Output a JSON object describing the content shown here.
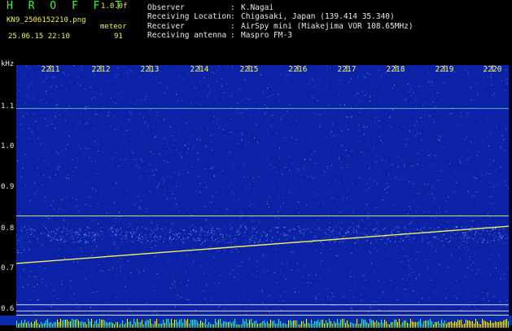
{
  "header": {
    "title": "H R O F F T",
    "version": "1.0.0f",
    "filename": "KN9_2506152210.png",
    "mode": "meteor",
    "datetime": "25.06.15 22:10",
    "count": "91",
    "fields": [
      {
        "label": "Observer",
        "value": "K.Nagai"
      },
      {
        "label": "Receiving Location",
        "value": "Chigasaki, Japan (139.414 35.340)"
      },
      {
        "label": "Receiver",
        "value": "AirSpy mini (Miakejima VOR 108.65MHz)"
      },
      {
        "label": "Receiving antenna",
        "value": "Maspro FM-3"
      }
    ],
    "separator": ":"
  },
  "spectrogram": {
    "y_unit": "kHz",
    "y_ticks": [
      "1.1",
      "1.0",
      "0.9",
      "0.8",
      "0.7",
      "0.6"
    ],
    "x_ticks": [
      "2211",
      "2212",
      "2213",
      "2214",
      "2215",
      "2216",
      "2217",
      "2218",
      "2219",
      "2220"
    ],
    "colors": {
      "background": "#0b22a6",
      "text_yellow": "#f4f24a",
      "text_green": "#3df43d",
      "trace": "#f0f060",
      "bottom_strip": "#3cd4f0"
    }
  },
  "chart_data": {
    "type": "heatmap",
    "x_axis_ticks": [
      "2211",
      "2212",
      "2213",
      "2214",
      "2215",
      "2216",
      "2217",
      "2218",
      "2219",
      "2220"
    ],
    "y_axis_unit": "kHz",
    "ylim": [
      0.59,
      1.2
    ],
    "horizontal_lines_khz": [
      1.095,
      0.835,
      0.62,
      0.605
    ],
    "drift_trace_khz": {
      "start": 0.72,
      "end": 0.81
    }
  }
}
